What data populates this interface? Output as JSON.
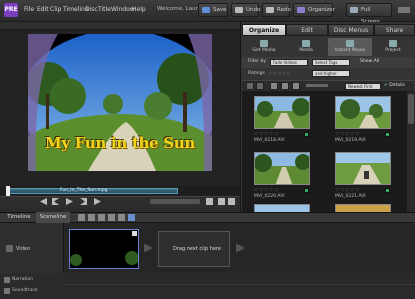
{
  "app": {
    "logo": "PRE"
  },
  "menu": [
    "File",
    "Edit",
    "Clip",
    "Timeline",
    "Disc",
    "Title",
    "Window",
    "Help"
  ],
  "welcome": "Welcome, Laura",
  "toolbar": {
    "save": "Save",
    "undo": "Undo",
    "redo": "Redo",
    "organizer": "Organizer",
    "fullscreen": "Full Screen"
  },
  "video": {
    "title_overlay": "My Fun in the Sun"
  },
  "scrub": {
    "clip_label": "Fun_In_The_Sun.mpg"
  },
  "right_panel": {
    "tabs": [
      "Organize",
      "Edit",
      "Disc Menus",
      "Share"
    ],
    "subtabs": [
      "Get Media",
      "Media",
      "Instant Movie",
      "Project"
    ],
    "filter": {
      "label": "Filter by",
      "dd1": "Fade Videos",
      "dd2": "Select Tags",
      "show_all": "Show All",
      "ratings_label": "Ratings",
      "dd3": "and higher"
    },
    "sort": "Newest First",
    "details": "Details",
    "media": [
      {
        "stars": "☆☆☆☆☆",
        "name": "MVI_0218.AVI"
      },
      {
        "stars": "☆☆☆☆☆",
        "name": "MVI_0219.AVI"
      },
      {
        "stars": "☆☆☆☆☆",
        "name": "MVI_0220.AVI"
      },
      {
        "stars": "☆☆☆☆☆",
        "name": "MVI_0221.AVI"
      }
    ]
  },
  "timeline": {
    "tabs": [
      "Timeline",
      "Sceneline"
    ],
    "track_label": "Video",
    "drag_hint": "Drag next clip here",
    "narration": "Narration",
    "soundtrack": "Soundtrack"
  }
}
